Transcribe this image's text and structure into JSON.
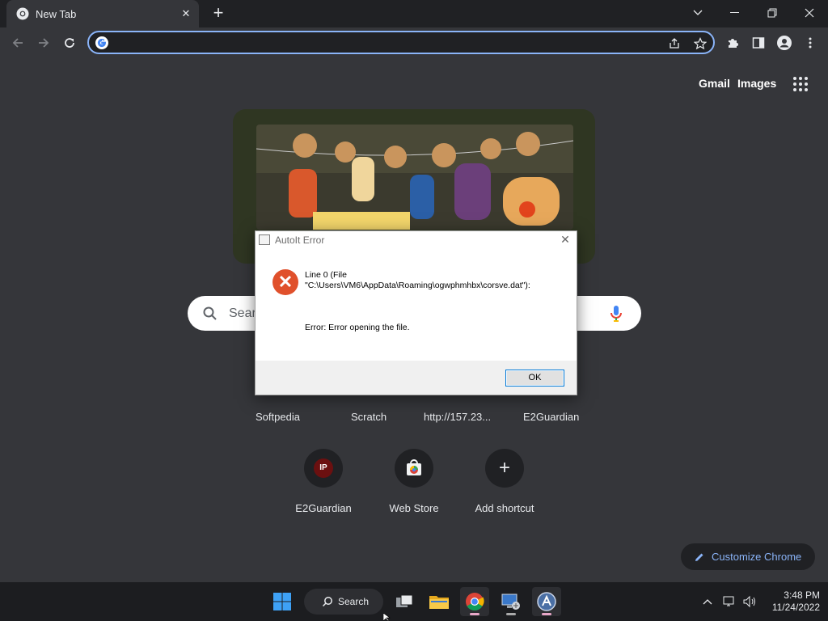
{
  "browser": {
    "tab": {
      "title": "New Tab",
      "icon": "chrome-icon"
    },
    "omnibox": {
      "value": "",
      "placeholder": ""
    }
  },
  "ntp": {
    "header_links": [
      "Gmail",
      "Images"
    ],
    "search": {
      "placeholder": "Sear"
    },
    "shortcuts_row1": [
      "Softpedia",
      "Scratch",
      "http://157.23...",
      "E2Guardian"
    ],
    "shortcuts_row2": [
      {
        "label": "E2Guardian",
        "badge": "IP"
      },
      {
        "label": "Web Store"
      },
      {
        "label": "Add shortcut",
        "symbol": "+"
      }
    ],
    "customize_label": "Customize Chrome"
  },
  "dialog": {
    "title": "AutoIt Error",
    "line1": "Line 0  (File",
    "line2": "\"C:\\Users\\VM6\\AppData\\Roaming\\ogwphmhbx\\corsve.dat\"):",
    "message": "Error: Error opening the file.",
    "ok_label": "OK",
    "close_glyph": "✕",
    "error_glyph": "✕"
  },
  "taskbar": {
    "search_label": "Search",
    "time": "3:48 PM",
    "date": "11/24/2022"
  },
  "colors": {
    "accent": "#8ab4f8",
    "background": "#35363a",
    "error": "#e0502b"
  }
}
